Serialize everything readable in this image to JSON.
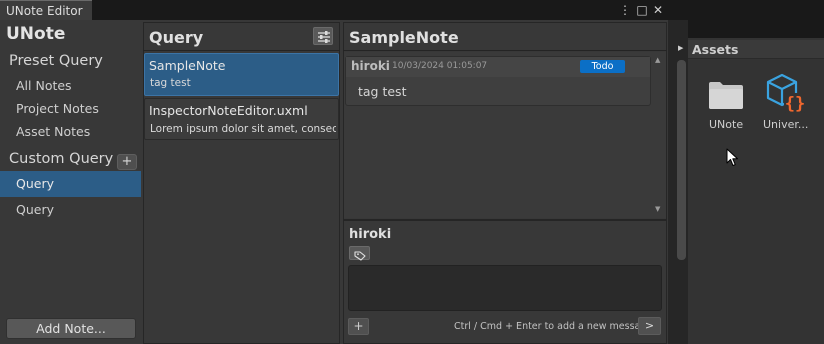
{
  "window": {
    "tab_title": "UNote Editor",
    "controls": [
      "⋮",
      "□",
      "✕"
    ]
  },
  "sidebar": {
    "app_title": "UNote",
    "preset_query_heading": "Preset Query",
    "preset_items": [
      {
        "label": "All Notes"
      },
      {
        "label": "Project Notes"
      },
      {
        "label": "Asset Notes"
      }
    ],
    "custom_query_heading": "Custom Query",
    "add_query_label": "+",
    "custom_items": [
      {
        "label": "Query",
        "selected": true
      },
      {
        "label": "Query",
        "selected": false
      }
    ],
    "add_note_label": "Add Note..."
  },
  "query_column": {
    "title": "Query",
    "filter_icon": "sliders-icon",
    "notes": [
      {
        "title": "SampleNote",
        "subtitle": "tag test",
        "selected": true
      },
      {
        "title": "InspectorNoteEditor.uxml",
        "subtitle": "Lorem ipsum dolor sit amet, consect...",
        "selected": false
      }
    ]
  },
  "detail_column": {
    "title": "SampleNote",
    "message": {
      "author": "hiroki",
      "timestamp": "10/03/2024 01:05:07",
      "badge": "Todo",
      "text": "tag test"
    },
    "composer": {
      "author": "hiroki",
      "tag_icon": "tag-icon",
      "input_value": "",
      "attach_label": "+",
      "hint": "Ctrl / Cmd + Enter to add a new message",
      "send_label": ">"
    }
  },
  "assets_panel": {
    "title": "Assets",
    "items": [
      {
        "label": "UNote",
        "icon": "folder-icon"
      },
      {
        "label": "Univer...",
        "icon": "uxml-asset-icon"
      }
    ]
  },
  "colors": {
    "accent_selected": "#2c5d87",
    "badge_todo": "#0b6fc6"
  }
}
